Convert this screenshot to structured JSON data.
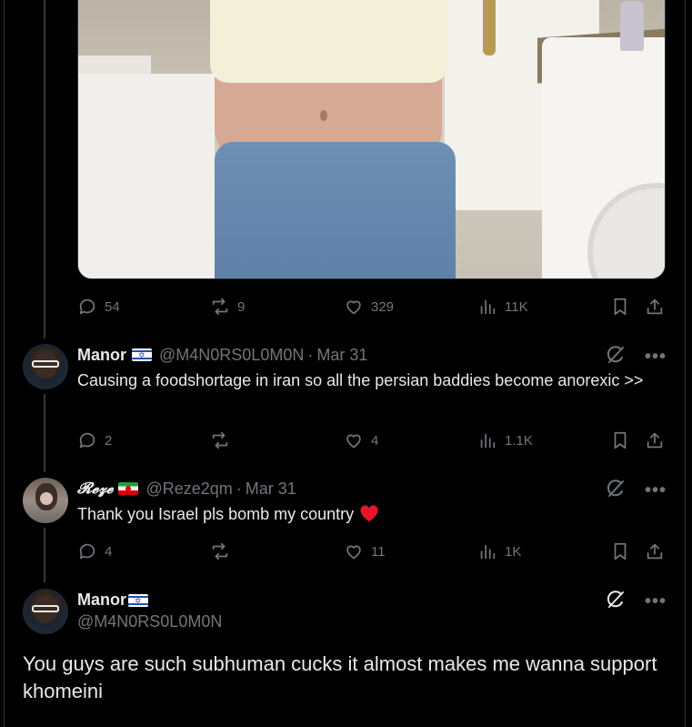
{
  "media": {
    "description_icon": "photo"
  },
  "tweet1_actions": {
    "replies": "54",
    "retweets": "9",
    "likes": "329",
    "views": "11K"
  },
  "tweet2": {
    "name": "Manor",
    "flag": "israel-flag",
    "handle": "@M4N0RS0L0M0N",
    "separator": "·",
    "date": "Mar 31",
    "text": "Causing a foodshortage in iran so all the persian baddies become anorexic >>",
    "replies": "2",
    "retweets": "",
    "likes": "4",
    "views": "1.1K"
  },
  "tweet3": {
    "name": "𝓡𝓮𝔃𝓮",
    "flag": "iran-flag",
    "handle": "@Reze2qm",
    "separator": "·",
    "date": "Mar 31",
    "text": "Thank you Israel pls bomb my country",
    "emoji": "red-heart",
    "replies": "4",
    "retweets": "",
    "likes": "11",
    "views": "1K"
  },
  "main_tweet": {
    "name": "Manor",
    "flag": "israel-flag",
    "handle": "@M4N0RS0L0M0N",
    "text": "You guys are such subhuman cucks it almost makes me wanna support khomeini"
  },
  "colors": {
    "background": "#000000",
    "text": "#e7e9ea",
    "muted": "#71767b",
    "border": "#2f3336"
  }
}
